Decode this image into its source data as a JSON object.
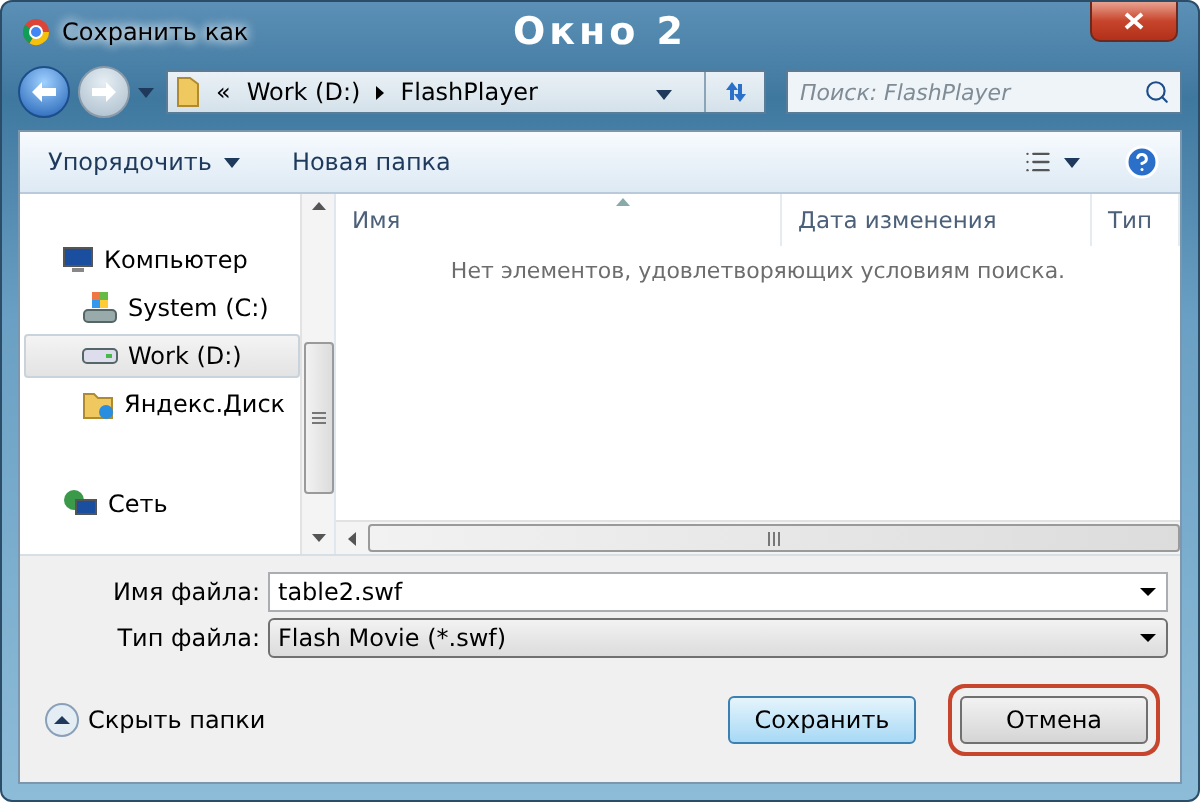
{
  "window": {
    "title": "Сохранить как",
    "caption": "Окно 2"
  },
  "address": {
    "overflow": "«",
    "path": [
      "Work (D:)",
      "FlashPlayer"
    ]
  },
  "search": {
    "placeholder": "Поиск: FlashPlayer"
  },
  "toolbar": {
    "organize": "Упорядочить",
    "new_folder": "Новая папка"
  },
  "nav": {
    "items": [
      {
        "label": "Компьютер",
        "kind": "computer",
        "selected": false,
        "children": [
          {
            "label": "System (C:)",
            "kind": "system",
            "selected": false
          },
          {
            "label": "Work (D:)",
            "kind": "drive",
            "selected": true
          },
          {
            "label": "Яндекс.Диск",
            "kind": "folder",
            "selected": false
          }
        ]
      },
      {
        "label": "Сеть",
        "kind": "network",
        "selected": false
      }
    ]
  },
  "columns": [
    "Имя",
    "Дата изменения",
    "Тип"
  ],
  "empty_message": "Нет элементов, удовлетворяющих условиям поиска.",
  "fields": [
    {
      "label": "Имя файла:",
      "value": "table2.swf",
      "kind": "combo-input"
    },
    {
      "label": "Тип файла:",
      "value": "Flash Movie (*.swf)",
      "kind": "select"
    }
  ],
  "hide_folders": "Скрыть папки",
  "buttons": [
    {
      "label": "Сохранить",
      "default": true,
      "highlighted": false
    },
    {
      "label": "Отмена",
      "default": false,
      "highlighted": true
    }
  ]
}
